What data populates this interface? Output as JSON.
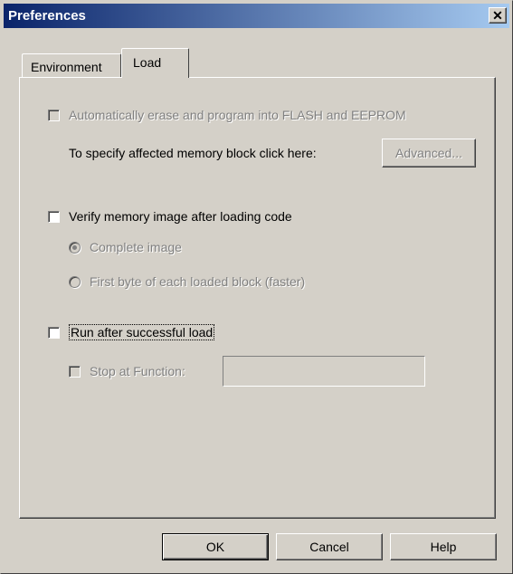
{
  "window": {
    "title": "Preferences",
    "close_glyph": "✕"
  },
  "tabs": [
    {
      "label": "Environment",
      "selected": false
    },
    {
      "label": "Load",
      "selected": true
    }
  ],
  "load": {
    "auto_erase": {
      "label": "Automatically erase and program into FLASH and EEPROM",
      "checked": false,
      "enabled": false
    },
    "memory_block_text": "To specify affected memory block click here:",
    "advanced_label": "Advanced...",
    "verify": {
      "label": "Verify memory image after loading code",
      "checked": false,
      "enabled": true
    },
    "radio_complete": {
      "label": "Complete image",
      "selected": true,
      "enabled": false
    },
    "radio_first_byte": {
      "label": "First byte of each loaded block (faster)",
      "selected": false,
      "enabled": false
    },
    "run_after": {
      "label": "Run after successful load",
      "checked": false,
      "enabled": true
    },
    "stop_at": {
      "label": "Stop at Function:",
      "checked": false,
      "enabled": false,
      "value": ""
    }
  },
  "buttons": {
    "ok": "OK",
    "cancel": "Cancel",
    "help": "Help"
  }
}
